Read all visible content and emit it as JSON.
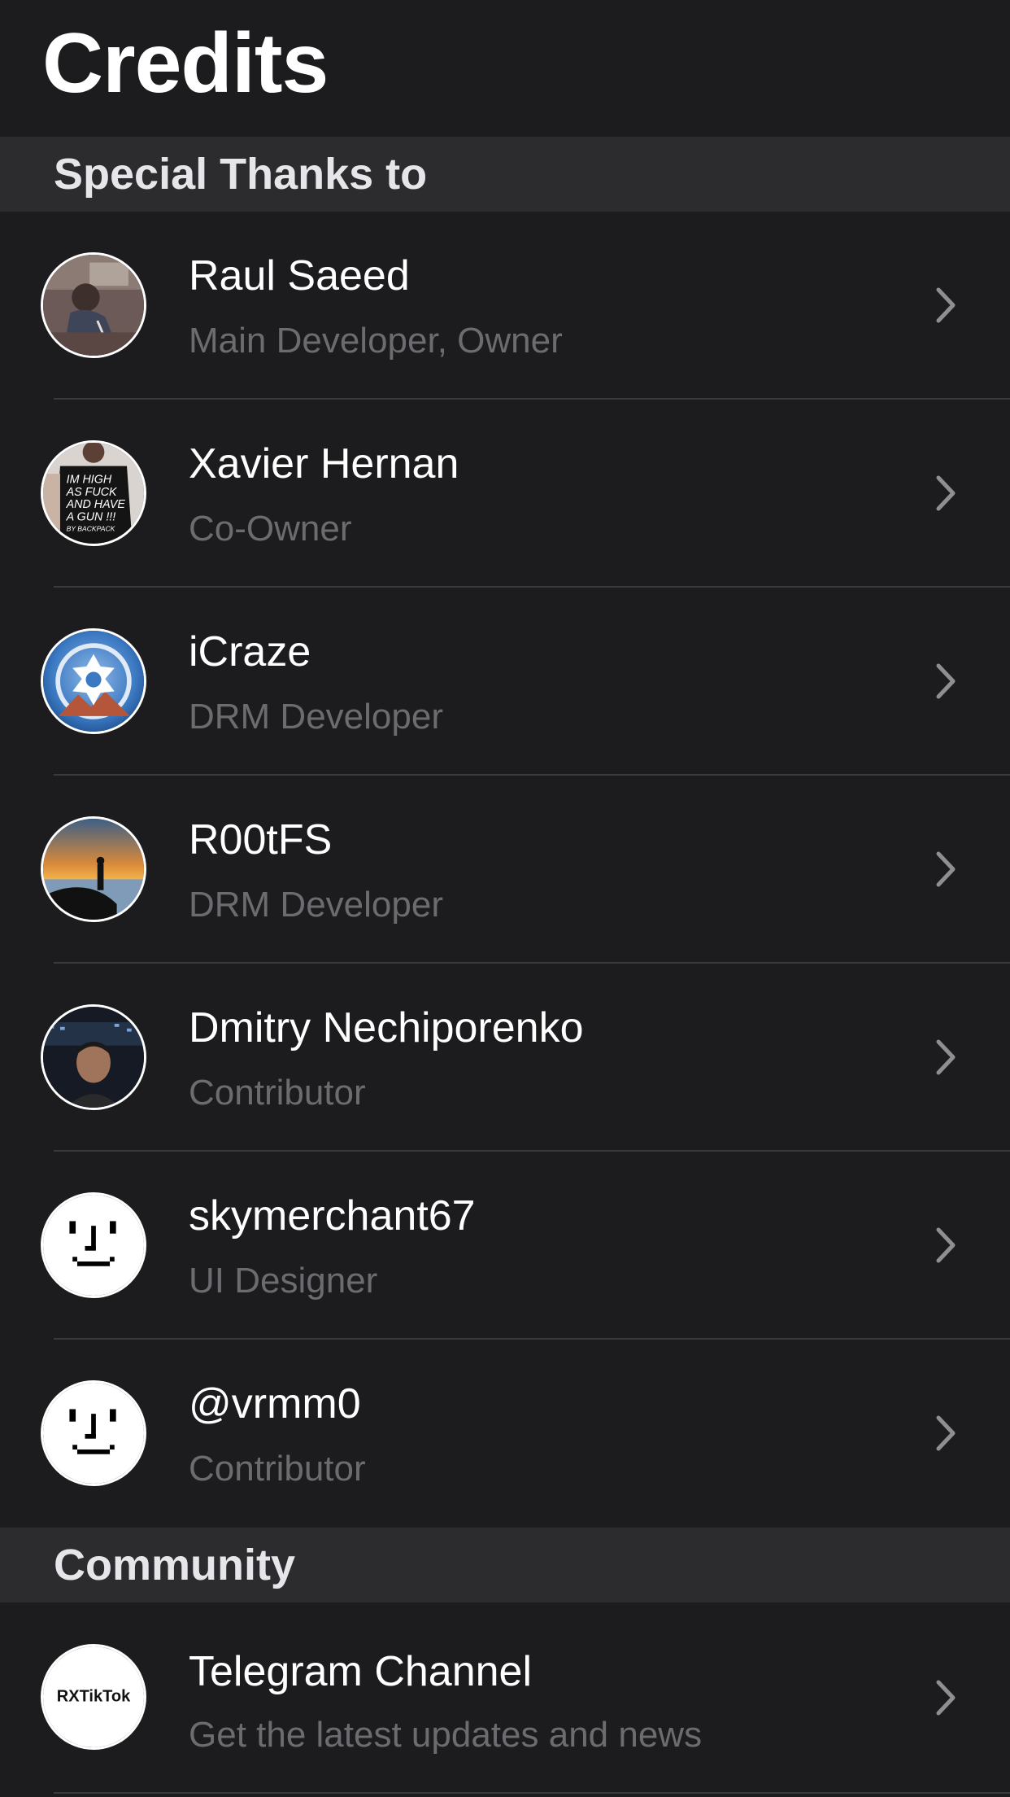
{
  "page": {
    "title": "Credits"
  },
  "sections": {
    "thanks": {
      "label": "Special Thanks to"
    },
    "community": {
      "label": "Community"
    }
  },
  "contributors": [
    {
      "name": "Raul Saeed",
      "role": "Main Developer, Owner",
      "avatar_icon": "photo-avatar"
    },
    {
      "name": "Xavier Hernan",
      "role": "Co-Owner",
      "avatar_icon": "photo-avatar"
    },
    {
      "name": "iCraze",
      "role": "DRM Developer",
      "avatar_icon": "gear-logo-avatar"
    },
    {
      "name": "R00tFS",
      "role": "DRM Developer",
      "avatar_icon": "sunset-photo-avatar"
    },
    {
      "name": "Dmitry Nechiporenko",
      "role": "Contributor",
      "avatar_icon": "photo-avatar"
    },
    {
      "name": "skymerchant67",
      "role": "UI Designer",
      "avatar_icon": "pixel-face-avatar"
    },
    {
      "name": "@vrmm0",
      "role": "Contributor",
      "avatar_icon": "pixel-face-avatar"
    }
  ],
  "community": [
    {
      "name": "Telegram Channel",
      "description": "Get the latest updates and news",
      "avatar_text": "RXTikTok"
    }
  ],
  "colors": {
    "background": "#1c1c1e",
    "section_background": "#2c2c2e",
    "subtitle": "#6b6b70",
    "chevron": "#8e8e93"
  },
  "icons": {
    "disclosure": "chevron-right-icon"
  }
}
